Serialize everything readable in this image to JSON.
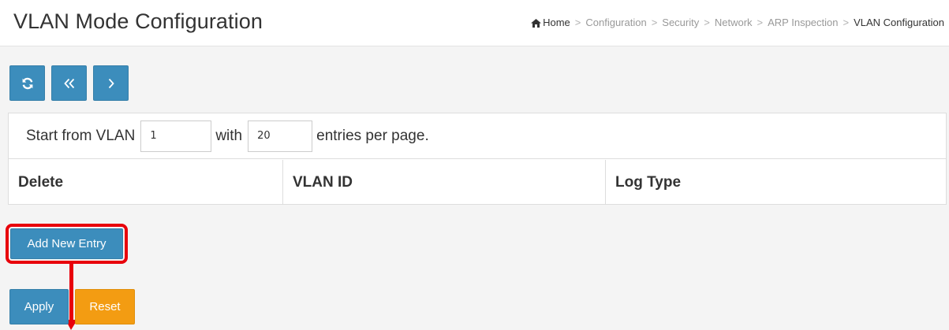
{
  "header": {
    "title": "VLAN Mode Configuration",
    "breadcrumb": [
      "Home",
      "Configuration",
      "Security",
      "Network",
      "ARP Inspection",
      "VLAN Configuration"
    ]
  },
  "toolbar": {
    "refresh_icon": "refresh-icon",
    "first_page_icon": "double-chevron-left-icon",
    "next_page_icon": "chevron-right-icon"
  },
  "paging": {
    "start_label": "Start from VLAN",
    "start_value": "1",
    "with_label": "with",
    "entries_value": "20",
    "entries_label": "entries per page."
  },
  "table": {
    "columns": [
      "Delete",
      "VLAN ID",
      "Log Type"
    ]
  },
  "buttons": {
    "add_new_entry": "Add New Entry",
    "apply": "Apply",
    "reset": "Reset"
  },
  "colors": {
    "primary": "#3c8dbc",
    "warning": "#f39c12",
    "annotation": "#e8000b"
  }
}
